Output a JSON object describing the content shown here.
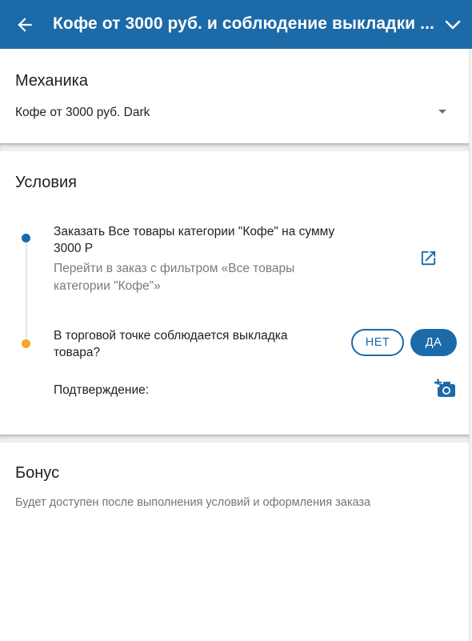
{
  "appbar": {
    "title": "Кофе от 3000 руб. и соблюдение выкладки ..."
  },
  "mechanics": {
    "heading": "Механика",
    "selected": "Кофе от 3000 руб. Dark"
  },
  "conditions": {
    "heading": "Условия",
    "items": [
      {
        "title_line1": "Заказать Все товары категории \"Кофе\" на сумму",
        "title_line2": "3000 Р",
        "link_line1": "Перейти в заказ с фильтром «Все товары",
        "link_line2": "категории \"Кофе\"»",
        "dot_color": "#1c6aa8"
      },
      {
        "title_line1": "В торговой точке соблюдается выкладка",
        "title_line2": "товара?",
        "no_label": "НЕТ",
        "yes_label": "ДА",
        "confirmation_label": "Подтверждение:",
        "dot_color": "#f5a623"
      }
    ]
  },
  "bonus": {
    "heading": "Бонус",
    "text": "Будет доступен после выполнения условий и оформления заказа"
  },
  "colors": {
    "primary": "#1c6aa8",
    "accent_dot": "#f5a623"
  }
}
